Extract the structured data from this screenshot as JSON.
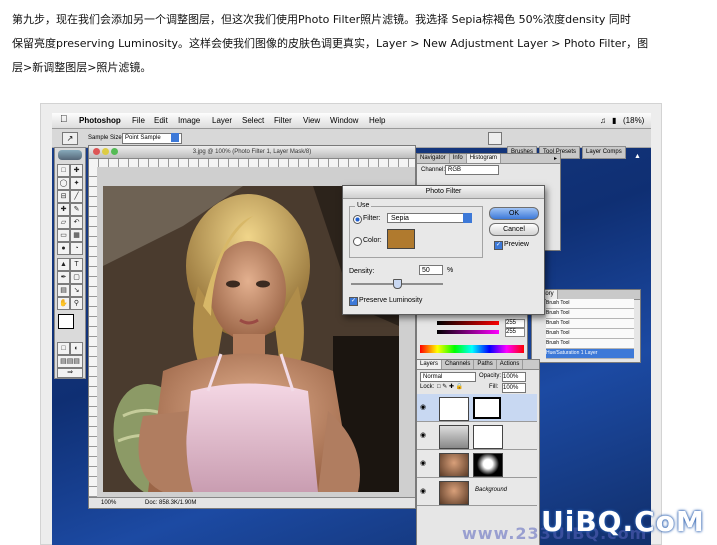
{
  "article": {
    "line1": "第九步，现在我们会添加另一个调整图层，但这次我们使用Photo Filter照片滤镜。我选择 Sepia棕褐色 50%浓度density 同时",
    "line2": "保留亮度preserving Luminosity。这样会使我们图像的皮肤色调更真实，Layer > New Adjustment Layer > Photo Filter，图",
    "line3": "层>新调整图层>照片滤镜。"
  },
  "menubar": {
    "app": "Photoshop",
    "items": [
      "File",
      "Edit",
      "Image",
      "Layer",
      "Select",
      "Filter",
      "View",
      "Window",
      "Help"
    ],
    "battery": "(18%)"
  },
  "options": {
    "sample_label": "Sample Size:",
    "sample_value": "Point Sample"
  },
  "panel_well": [
    "Brushes",
    "Tool Presets",
    "Layer Comps"
  ],
  "document": {
    "title": "3.jpg @ 100% (Photo Filter 1, Layer Mask/8)",
    "zoom": "100%",
    "doc_info": "Doc: 858.3K/1.90M"
  },
  "navigator": {
    "tabs": [
      "Navigator",
      "Info",
      "Histogram"
    ],
    "channel_label": "Channel:",
    "channel_value": "RGB"
  },
  "photo_filter": {
    "title": "Photo Filter",
    "use_label": "Use",
    "filter_label": "Filter:",
    "filter_value": "Sepia",
    "color_label": "Color:",
    "color_swatch": "#b07a2e",
    "density_label": "Density:",
    "density_value": "50",
    "density_unit": "%",
    "density_fraction": 0.5,
    "preserve_label": "Preserve Luminosity",
    "ok": "OK",
    "cancel": "Cancel",
    "preview": "Preview"
  },
  "history": {
    "tab": "History",
    "items": [
      "Brush Tool",
      "Brush Tool",
      "Brush Tool",
      "Brush Tool",
      "Brush Tool",
      "Hue/Saturation 1 Layer"
    ]
  },
  "color_panel": {
    "value1": "255",
    "value2": "255"
  },
  "layers": {
    "tabs": [
      "Layers",
      "Channels",
      "Paths",
      "Actions"
    ],
    "blend_mode": "Normal",
    "opacity_label": "Opacity:",
    "opacity_value": "100%",
    "lock_label": "Lock:",
    "fill_label": "Fill:",
    "fill_value": "100%",
    "background_label": "Background"
  },
  "watermark": {
    "site": "www.233UiBQ.com",
    "logo": "UiBQ.CoM"
  },
  "colors": {
    "accent": "#3d79d8",
    "desktop": "#1b3f8a",
    "sepia": "#b07a2e"
  }
}
